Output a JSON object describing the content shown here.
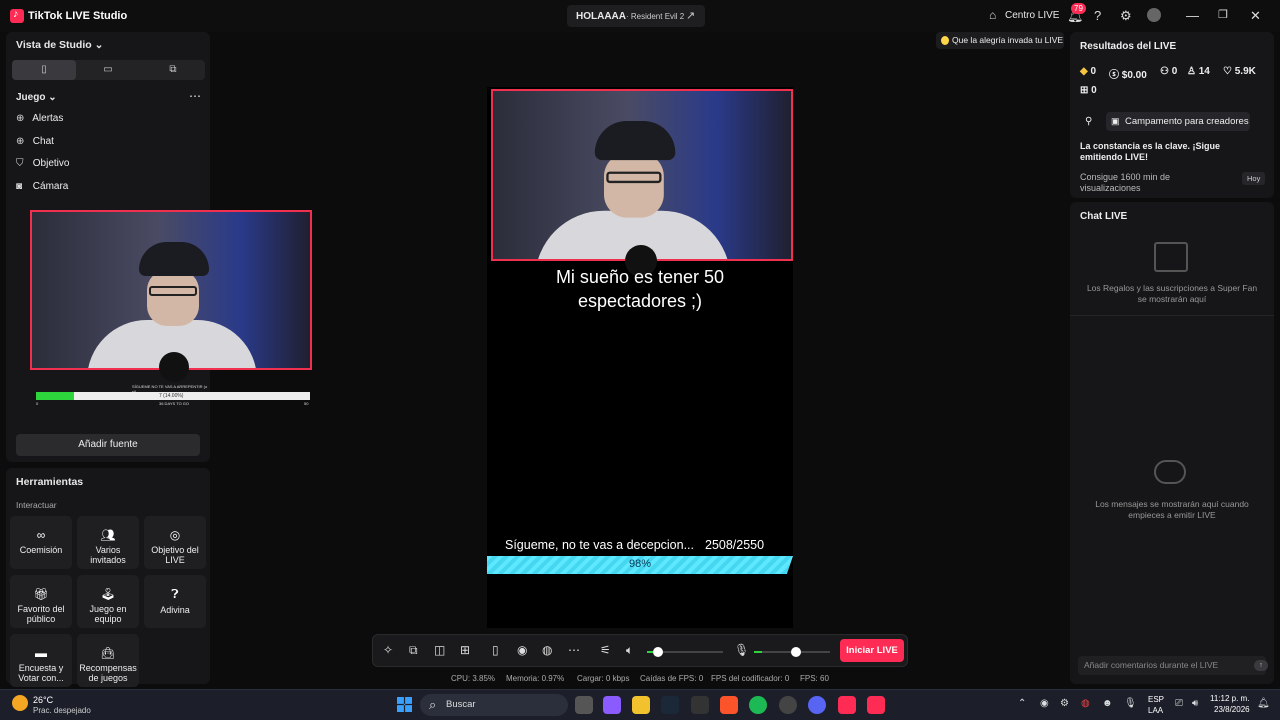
{
  "app": {
    "title": "TikTok LIVE Studio",
    "stream_title": "HOLAAAA",
    "stream_game": "Resident Evil 2",
    "live_center": "Centro LIVE",
    "notif_count": "79"
  },
  "left": {
    "studio_view": "Vista de Studio",
    "scene": "Juego",
    "sources": [
      {
        "icon": "globe-icon",
        "label": "Alertas"
      },
      {
        "icon": "globe-icon",
        "label": "Chat"
      },
      {
        "icon": "shield-icon",
        "label": "Objetivo"
      },
      {
        "icon": "camera-icon",
        "label": "Cámara"
      }
    ],
    "preview_goal_text": "SÍGUEME NO TE VAS A ARREPENTIR (o si)",
    "preview_goal_count": "7 (14.00%)",
    "preview_goal_min": "0",
    "preview_goal_max": "50",
    "preview_goal_sub": "36 DAYS TO GO",
    "preview_goal_fraction": 0.14,
    "add_source": "Añadir fuente"
  },
  "tools": {
    "title": "Herramientas",
    "section": "Interactuar",
    "items": [
      {
        "icon": "link-icon",
        "label": "Coemisión"
      },
      {
        "icon": "users-icon",
        "label": "Varios invitados"
      },
      {
        "icon": "target-icon",
        "label": "Objetivo del LIVE"
      },
      {
        "icon": "gift-icon",
        "label": "Favorito del público"
      },
      {
        "icon": "joystick-icon",
        "label": "Juego en equipo"
      },
      {
        "icon": "question-icon",
        "label": "Adivina"
      },
      {
        "icon": "poll-icon",
        "label": "Encuesta y Votar con..."
      },
      {
        "icon": "bag-icon",
        "label": "Recompensas de juegos"
      }
    ]
  },
  "stage": {
    "tip": "Que la alegría invada tu LIVE",
    "caption_line1": "Mi sueño es tener 50",
    "caption_line2": "espectadores ;)",
    "goal_text": "Sígueme, no te vas a decepcion...",
    "goal_count": "2508/2550",
    "goal_percent": "98%",
    "goal_fraction": 0.98
  },
  "controls": {
    "start_live": "Iniciar LIVE",
    "volume_level": 0.15,
    "mic_level": 0.55
  },
  "stats": {
    "cpu": "CPU:  3.85%",
    "memory": "Memoria:  0.97%",
    "upload": "Cargar:  0 kbps",
    "fps_drops": "Caídas de FPS:  0",
    "encoder_fps": "FPS del codificador:  0",
    "fps": "FPS:  60"
  },
  "results": {
    "title": "Resultados del LIVE",
    "diamonds": "0",
    "money": "$0.00",
    "viewers": "0",
    "new_followers": "14",
    "likes": "5.9K",
    "gifts": "0",
    "campaign": "Campamento para creadores",
    "msg_title": "La constancia es la clave. ¡Sigue emitiendo LIVE!",
    "msg_body": "Consigue 1600 min de visualizaciones",
    "msg_when": "Hoy"
  },
  "chat": {
    "title": "Chat LIVE",
    "gifts_note": "Los Regalos y las suscripciones a Super Fan se mostrarán aquí",
    "messages_note": "Los mensajes se mostrarán aquí cuando empieces a emitir LIVE",
    "input_placeholder": "Añadir comentarios durante el LIVE"
  },
  "taskbar": {
    "temp": "26°C",
    "weather": "Prac. despejado",
    "search": "Buscar",
    "lang1": "ESP",
    "lang2": "LAA",
    "time": "11:12 p. m.",
    "date": "23/8/2026",
    "colors": {
      "accent": "#fe2c55",
      "goal_green": "#2dd43b",
      "goal_cyan": "#5ee8ff"
    }
  }
}
